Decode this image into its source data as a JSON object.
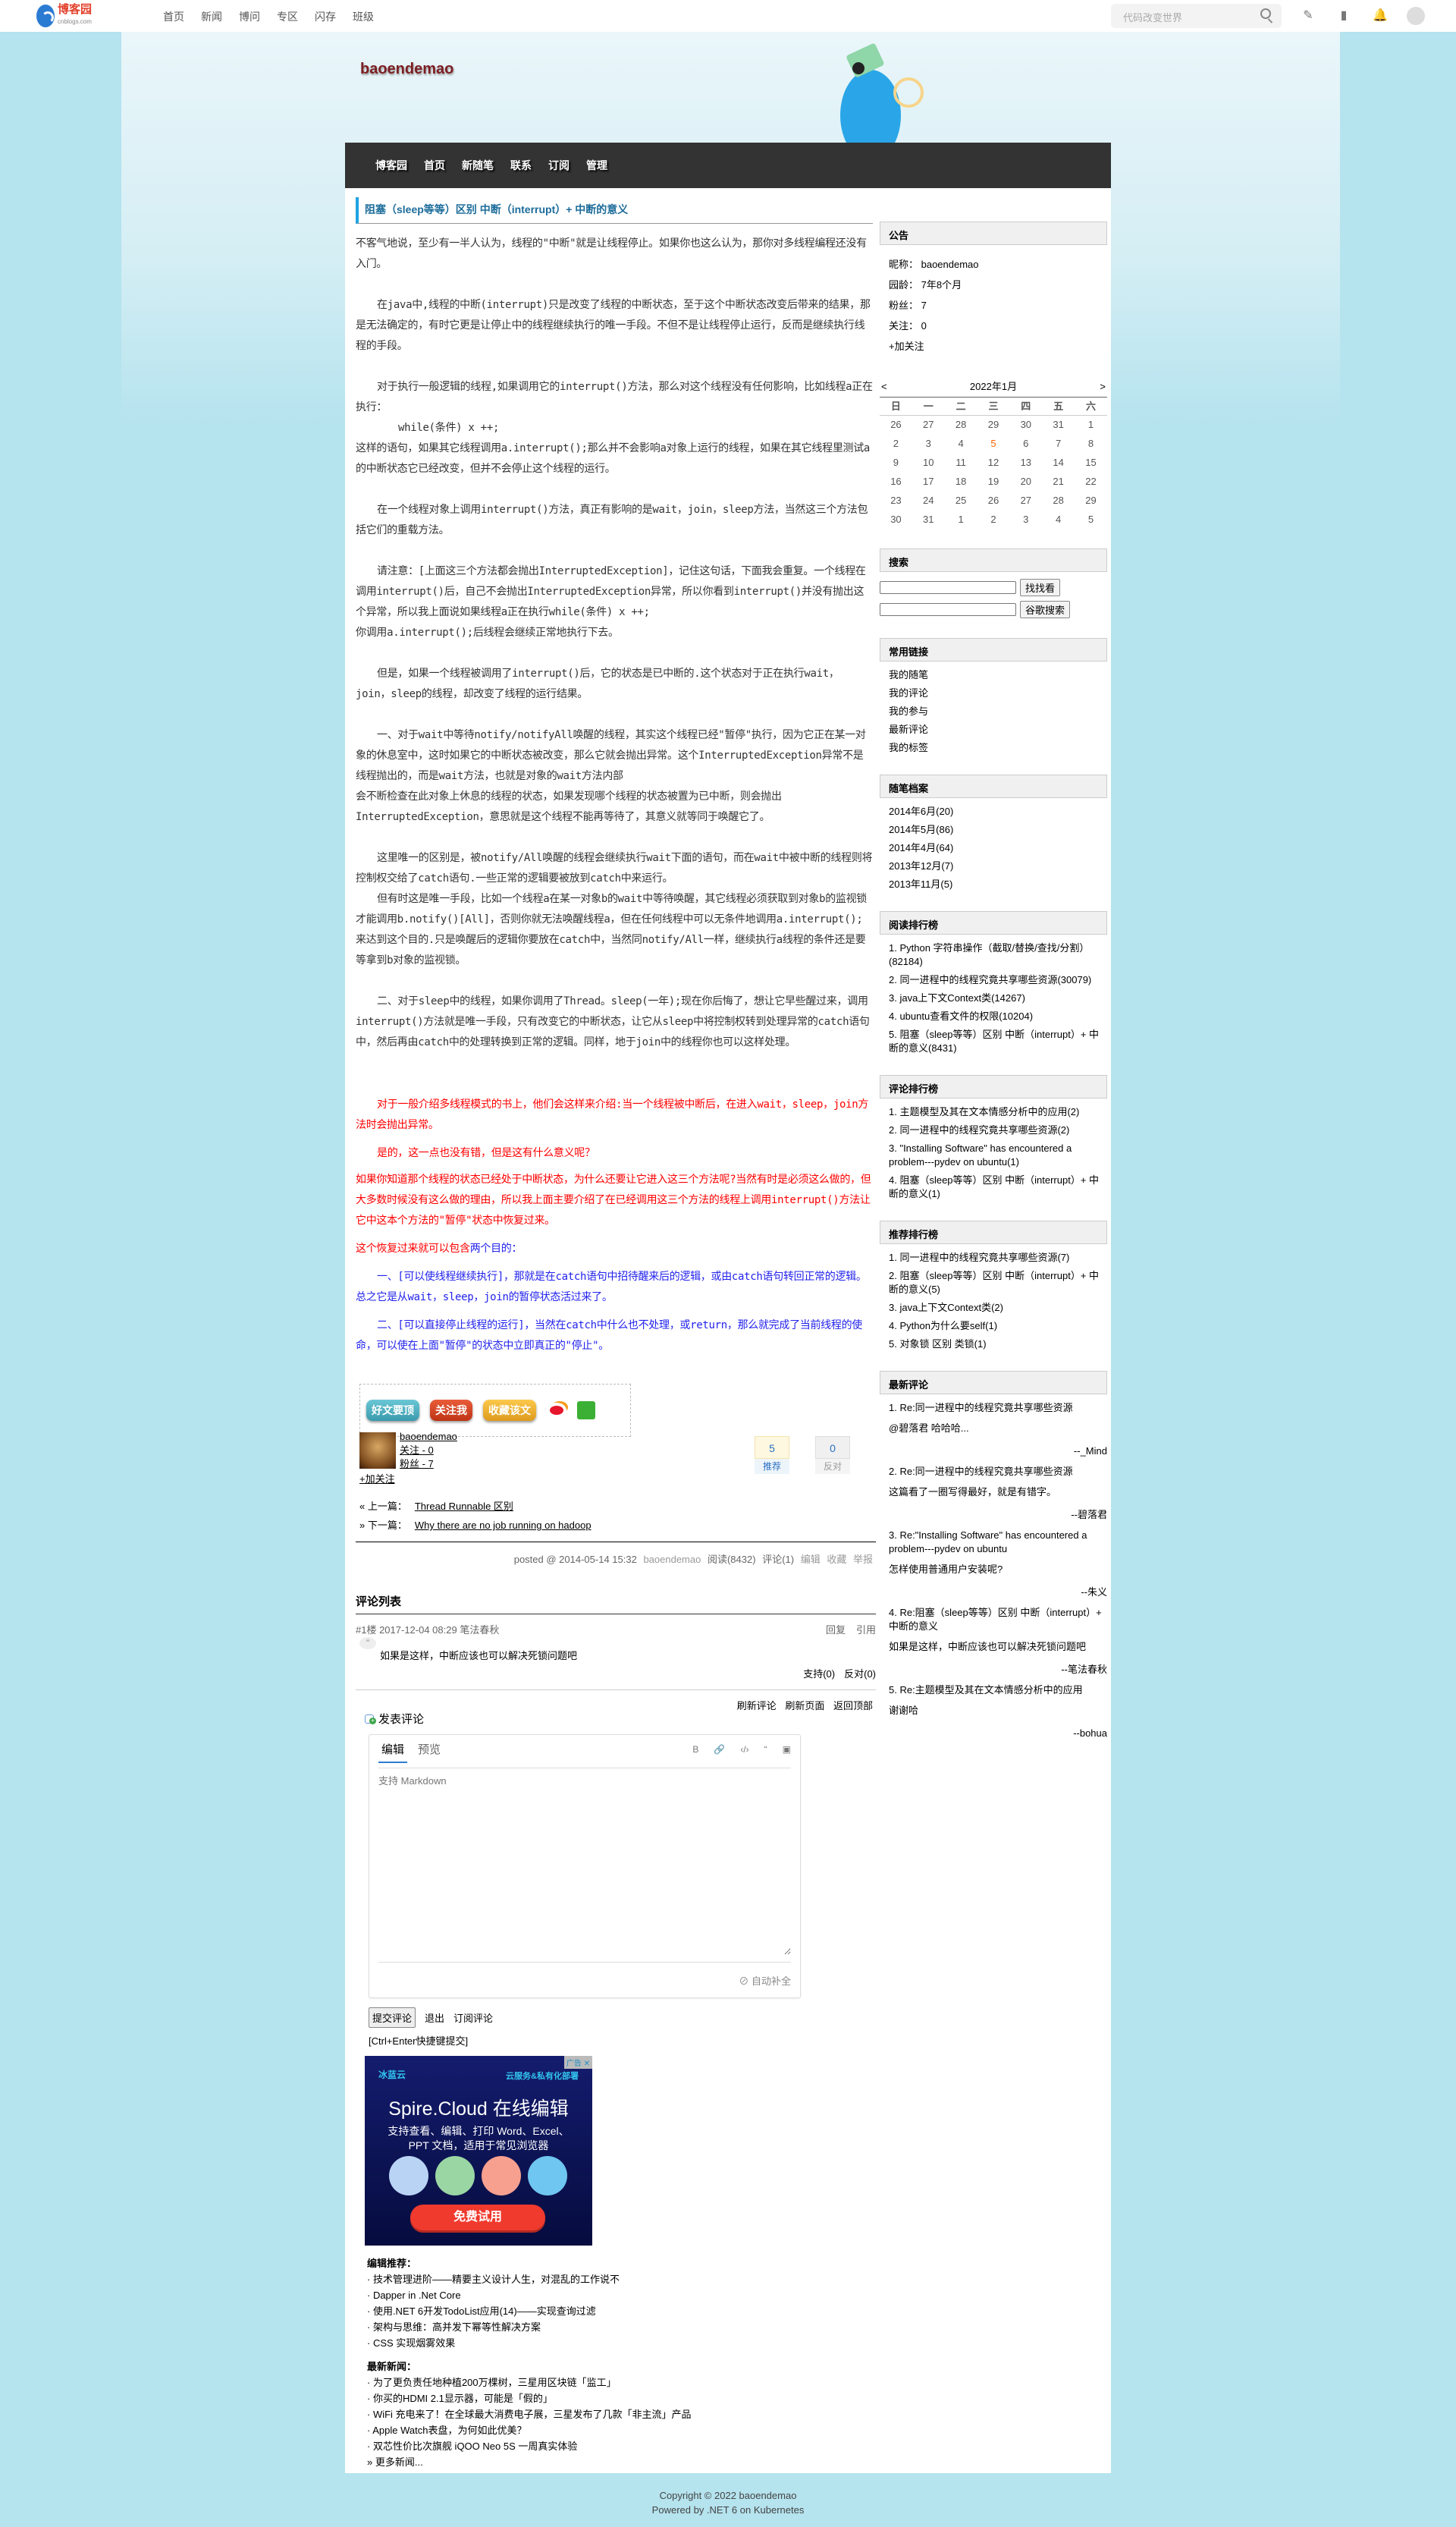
{
  "topbar": {
    "logo_text": "博客园",
    "logo_sub": "cnblogs.com",
    "nav": [
      "首页",
      "新闻",
      "博问",
      "专区",
      "闪存",
      "班级"
    ],
    "search_placeholder": "代码改变世界"
  },
  "blog": {
    "title": "baoendemao",
    "nav": [
      "博客园",
      "首页",
      "新随笔",
      "联系",
      "订阅",
      "管理"
    ]
  },
  "post": {
    "title": "阻塞（sleep等等）区别 中断（interrupt）+ 中断的意义",
    "paragraphs": [
      {
        "indent": false,
        "segments": [
          {
            "text": "不客气地说，至少有一半人认为，线程的\"中断\"就是让线程停止。如果你也这么认为，那你对多线程编程还没有入门。",
            "color": "#333333"
          }
        ]
      },
      {
        "indent": true,
        "segments": [
          {
            "text": "在java中,线程的中断(interrupt)只是改变了线程的中断状态，至于这个中断状态改变后带来的结果，那是无法确定的，有时它更是让停止中的线程继续执行的唯一手段。不但不是让线程停止运行，反而是继续执行线程的手段。",
            "color": "#333333"
          }
        ]
      },
      {
        "indent": true,
        "segments": [
          {
            "text": "对于执行一般逻辑的线程,如果调用它的interrupt()方法，那么对这个线程没有任何影响，比如线程a正在执行：",
            "color": "#333333"
          }
        ]
      },
      {
        "indent": false,
        "code": true,
        "segments": [
          {
            "text": "while(条件)  x  ++;",
            "color": "#333333"
          }
        ]
      },
      {
        "indent": false,
        "segments": [
          {
            "text": "这样的语句，如果其它线程调用a.interrupt();那么并不会影响a对象上运行的线程，如果在其它线程里测试a的中断状态它已经改变，但并不会停止这个线程的运行。",
            "color": "#333333"
          }
        ]
      },
      {
        "indent": true,
        "segments": [
          {
            "text": "在一个线程对象上调用interrupt()方法，真正有影响的是wait，join，sleep方法，当然这三个方法包括它们的重载方法。",
            "color": "#333333"
          }
        ]
      },
      {
        "indent": true,
        "segments": [
          {
            "text": "请注意：[上面这三个方法都会抛出InterruptedException]，记住这句话，下面我会重复。一个线程在调用interrupt()后，自己不会抛出InterruptedException异常，所以你看到interrupt()并没有抛出这个异常，所以我上面说如果线程a正在执行while(条件) x ++;",
            "color": "#333333"
          }
        ]
      },
      {
        "indent": false,
        "segments": [
          {
            "text": "你调用a.interrupt();后线程会继续正常地执行下去。",
            "color": "#333333"
          }
        ]
      },
      {
        "indent": true,
        "segments": [
          {
            "text": "但是，如果一个线程被调用了interrupt()后，它的状态是已中断的.这个状态对于正在执行wait，join，sleep的线程，却改变了线程的运行结果。",
            "color": "#333333"
          }
        ]
      },
      {
        "indent": true,
        "segments": [
          {
            "text": "一、对于wait中等待notify/notifyAll唤醒的线程，其实这个线程已经\"暂停\"执行，因为它正在某一对象的休息室中，这时如果它的中断状态被改变，那么它就会抛出异常。这个InterruptedException异常不是线程抛出的，而是wait方法，也就是对象的wait方法内部",
            "color": "#333333"
          }
        ]
      },
      {
        "indent": false,
        "segments": [
          {
            "text": "会不断检查在此对象上休息的线程的状态，如果发现哪个线程的状态被置为已中断，则会抛出InterruptedException，意思就是这个线程不能再等待了，其意义就等同于唤醒它了。",
            "color": "#333333"
          }
        ]
      },
      {
        "indent": true,
        "segments": [
          {
            "text": "这里唯一的区别是，被notify/All唤醒的线程会继续执行wait下面的语句，而在wait中被中断的线程则将控制权交给了catch语句.一些正常的逻辑要被放到catch中来运行。",
            "color": "#333333"
          }
        ]
      },
      {
        "indent": true,
        "segments": [
          {
            "text": "但有时这是唯一手段，比如一个线程a在某一对象b的wait中等待唤醒，其它线程必须获取到对象b的监视锁才能调用b.notify()[All]，否则你就无法唤醒线程a，但在任何线程中可以无条件地调用a.interrupt();来达到这个目的.只是唤醒后的逻辑你要放在catch中，当然同notify/All一样，继续执行a线程的条件还是要等拿到b对象的监视锁。",
            "color": "#333333"
          }
        ]
      },
      {
        "indent": true,
        "segments": [
          {
            "text": "二、对于sleep中的线程，如果你调用了Thread。sleep(一年);现在你后悔了，想让它早些醒过来，调用interrupt()方法就是唯一手段，只有改变它的中断状态，让它从sleep中将控制权转到处理异常的catch语句中，然后再由catch中的处理转换到正常的逻辑。同样，地于join中的线程你也可以这样处理。",
            "color": "#333333"
          }
        ]
      },
      {
        "indent": true,
        "segments": [
          {
            "text": "对于一般介绍多线程模式的书上，他们会这样来介绍:当一个线程被中断后，在进入wait，sleep，join方法时会抛出异常。",
            "color": "#ff0000"
          }
        ]
      },
      {
        "indent": true,
        "segments": [
          {
            "text": "是的，这一点也没有错，但是这有什么意义呢？",
            "color": "#ff0000"
          }
        ]
      },
      {
        "indent": false,
        "segments": [
          {
            "text": "如果你知道那个线程的状态已经处于中断状态，为什么还要让它进入这三个方法呢?当然有时是必须这么做的，但大多数时候没有这么做的理由，所以我上面主要介绍了在已经调用这三个方法的线程上调用interrupt()方法让它中这本个方法的\"暂停\"状态中恢复过来。",
            "color": "#ff0000"
          }
        ]
      },
      {
        "indent": false,
        "segments": [
          {
            "text": "这个恢复过来就可以包含",
            "color": "#ff0000"
          },
          {
            "text": "两个目的：",
            "color": "#2222ee"
          }
        ]
      },
      {
        "indent": true,
        "segments": [
          {
            "text": "一、[可以使线程继续执行]，那就是在catch语句中招待醒来后的逻辑，或由catch语句转回正常的逻辑。总之它是从wait，sleep，join的暂停状态活过来了。",
            "color": "#2222ee"
          }
        ]
      },
      {
        "indent": true,
        "segments": [
          {
            "text": "二、[可以直接停止线程的运行]，当然在catch中什么也不处理，或return，那么就完成了当前线程的使命，可以使在上面\"暂停\"的状态中立即真正的\"停止\"。",
            "color": "#2222ee"
          }
        ]
      }
    ],
    "share_buttons": [
      "好文要顶",
      "关注我",
      "收藏该文"
    ],
    "author": {
      "name": "baoendemao",
      "following": "关注 - 0",
      "followers": "粉丝 - 7",
      "follow_link": "+加关注"
    },
    "votes": {
      "digg_count": "5",
      "digg_label": "推荐",
      "bury_count": "0",
      "bury_label": "反对"
    },
    "prev": {
      "label": "« 上一篇：",
      "title": "Thread Runnable 区别"
    },
    "next": {
      "label": "» 下一篇：",
      "title": "Why there are no job running on hadoop"
    },
    "footer": {
      "posted": "posted @ 2014-05-14 15:32",
      "author": "baoendemao",
      "reads": "阅读(8432)",
      "comments": "评论(1)",
      "edit": "编辑",
      "favorite": "收藏",
      "report": "举报"
    }
  },
  "comments": {
    "title": "评论列表",
    "items": [
      {
        "header": "#1楼 2017-12-04 08:29 笔法春秋",
        "reply": "回复",
        "quote": "引用",
        "text": "如果是这样，中断应该也可以解决死锁问题吧",
        "support": "支持(0)",
        "oppose": "反对(0)"
      }
    ],
    "links": [
      "刷新评论",
      "刷新页面",
      "返回顶部"
    ],
    "post_title": "发表评论",
    "editor": {
      "tab_edit": "编辑",
      "tab_preview": "预览",
      "tools": [
        "B",
        "🔗",
        "‹/›",
        "“",
        "▣"
      ],
      "placeholder": "支持 Markdown",
      "autocomplete": "自动补全"
    },
    "submit": "提交评论",
    "logout": "退出",
    "subscribe": "订阅评论",
    "hint": "[Ctrl+Enter快捷键提交]"
  },
  "ad": {
    "tag": "广告",
    "close": "✕",
    "brand": "冰蓝云",
    "slogan": "云服务&私有化部署",
    "headline": "Spire.Cloud 在线编辑",
    "desc": "支持查看、编辑、打印 Word、Excel、PPT 文档，适用于常见浏览器",
    "cta": "免费试用"
  },
  "recommend": {
    "editor_title": "编辑推荐：",
    "editor_items": [
      "· 技术管理进阶——精要主义设计人生，对混乱的工作说不",
      "· Dapper in .Net Core",
      "· 使用.NET 6开发TodoList应用(14)——实现查询过滤",
      "· 架构与思维：高并发下幂等性解决方案",
      "· CSS 实现烟雾效果"
    ],
    "news_title": "最新新闻：",
    "news_items": [
      "· 为了更负责任地种植200万棵树，三星用区块链「监工」",
      "· 你买的HDMI 2.1显示器，可能是「假的」",
      "· WiFi 充电来了！在全球最大消费电子展，三星发布了几款「非主流」产品",
      "· Apple Watch表盘，为何如此优美？",
      "· 双芯性价比次旗舰 iQOO Neo 5S 一周真实体验"
    ],
    "more": "» 更多新闻..."
  },
  "sidebar": {
    "notice": {
      "title": "公告",
      "lines": [
        "昵称：  baoendemao",
        "园龄：  7年8个月",
        "粉丝：  7",
        "关注：  0"
      ],
      "follow": "+加关注"
    },
    "calendar": {
      "prev": "<",
      "next": ">",
      "month": "2022年1月",
      "weekdays": [
        "日",
        "一",
        "二",
        "三",
        "四",
        "五",
        "六"
      ],
      "weeks": [
        [
          "26",
          "27",
          "28",
          "29",
          "30",
          "31",
          "1"
        ],
        [
          "2",
          "3",
          "4",
          "5",
          "6",
          "7",
          "8"
        ],
        [
          "9",
          "10",
          "11",
          "12",
          "13",
          "14",
          "15"
        ],
        [
          "16",
          "17",
          "18",
          "19",
          "20",
          "21",
          "22"
        ],
        [
          "23",
          "24",
          "25",
          "26",
          "27",
          "28",
          "29"
        ],
        [
          "30",
          "31",
          "1",
          "2",
          "3",
          "4",
          "5"
        ]
      ],
      "today": "5",
      "today_color": "#ff6600"
    },
    "search": {
      "title": "搜索",
      "button1": "找找看",
      "button2": "谷歌搜索"
    },
    "links": {
      "title": "常用链接",
      "items": [
        "我的随笔",
        "我的评论",
        "我的参与",
        "最新评论",
        "我的标签"
      ]
    },
    "archive": {
      "title": "随笔档案",
      "items": [
        "2014年6月(20)",
        "2014年5月(86)",
        "2014年4月(64)",
        "2013年12月(7)",
        "2013年11月(5)"
      ]
    },
    "top_read": {
      "title": "阅读排行榜",
      "items": [
        "1. Python 字符串操作（截取/替换/查找/分割）(82184)",
        "2. 同一进程中的线程究竟共享哪些资源(30079)",
        "3. java上下文Context类(14267)",
        "4. ubuntu查看文件的权限(10204)",
        "5. 阻塞（sleep等等）区别 中断（interrupt）+ 中断的意义(8431)"
      ]
    },
    "top_comment": {
      "title": "评论排行榜",
      "items": [
        "1. 主题模型及其在文本情感分析中的应用(2)",
        "2. 同一进程中的线程究竟共享哪些资源(2)",
        "3. \"Installing Software\" has encountered a problem---pydev on ubuntu(1)",
        "4. 阻塞（sleep等等）区别 中断（interrupt）+ 中断的意义(1)"
      ]
    },
    "top_digg": {
      "title": "推荐排行榜",
      "items": [
        "1. 同一进程中的线程究竟共享哪些资源(7)",
        "2. 阻塞（sleep等等）区别 中断（interrupt）+ 中断的意义(5)",
        "3. java上下文Context类(2)",
        "4. Python为什么要self(1)",
        "5. 对象锁 区别 类锁(1)"
      ]
    },
    "recent_comments": {
      "title": "最新评论",
      "items": [
        {
          "title": "1. Re:同一进程中的线程究竟共享哪些资源",
          "body": "@碧落君 哈哈哈...",
          "author": "--_Mind"
        },
        {
          "title": "2. Re:同一进程中的线程究竟共享哪些资源",
          "body": "这篇看了一圈写得最好，就是有错字。",
          "author": "--碧落君"
        },
        {
          "title": "3. Re:\"Installing Software\" has encountered a problem---pydev on ubuntu",
          "body": "怎样使用普通用户安装呢?",
          "author": "--朱义"
        },
        {
          "title": "4. Re:阻塞（sleep等等）区别 中断（interrupt）+ 中断的意义",
          "body": "如果是这样，中断应该也可以解决死锁问题吧",
          "author": "--笔法春秋"
        },
        {
          "title": "5. Re:主题模型及其在文本情感分析中的应用",
          "body": "谢谢哈",
          "author": "--bohua"
        }
      ]
    }
  },
  "footer": {
    "copyright": "Copyright © 2022 baoendemao",
    "powered": "Powered by .NET 6 on Kubernetes"
  },
  "colors": {
    "accent": "#21a3e3",
    "nav_bg": "#333333",
    "page_bg": "#b5e3ee",
    "title_color": "#7b1f23"
  }
}
